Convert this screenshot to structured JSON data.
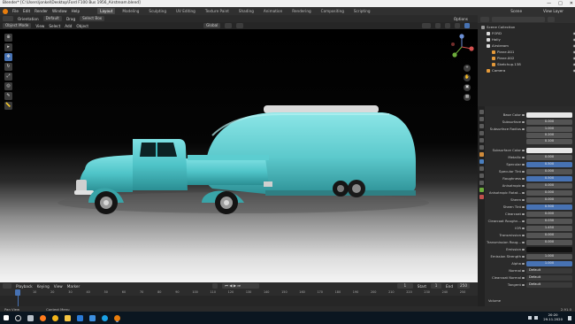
{
  "window": {
    "title": "Blender* [C:\\Users\\jonkel\\Desktop\\Ford F100 Bus 1956_Airstream.blend]",
    "controls": [
      "—",
      "□",
      "✕"
    ]
  },
  "menus": [
    "File",
    "Edit",
    "Render",
    "Window",
    "Help"
  ],
  "workspaces": [
    "Layout",
    "Modeling",
    "Sculpting",
    "UV Editing",
    "Texture Paint",
    "Shading",
    "Animation",
    "Rendering",
    "Compositing",
    "Scripting"
  ],
  "active_workspace": "Layout",
  "scene": {
    "label": "Scene",
    "view_layer": "View Layer"
  },
  "toolbar": {
    "orientation": "Orientation",
    "orientation_value": "Default",
    "drag_label": "Drag",
    "drag_value": "Select Box",
    "options_label": "Options"
  },
  "viewport_header": {
    "mode": "Object Mode",
    "menus": [
      "View",
      "Select",
      "Add",
      "Object"
    ],
    "transform_space": "Global"
  },
  "left_tools": [
    "cursor-icon",
    "select-icon",
    "move-icon",
    "rotate-icon",
    "scale-icon",
    "transform-icon",
    "annotate-icon",
    "measure-icon"
  ],
  "outliner": {
    "header": "Scene Collection",
    "rows": [
      {
        "name": "Scene Collection",
        "indent": 0,
        "color": "#9a9a9a",
        "eye": false
      },
      {
        "name": "FORD",
        "indent": 1,
        "color": "#d9d9d9",
        "eye": true
      },
      {
        "name": "Holly",
        "indent": 1,
        "color": "#d9d9d9",
        "eye": true
      },
      {
        "name": "Airstream",
        "indent": 1,
        "color": "#d9d9d9",
        "eye": true
      },
      {
        "name": "Plane.001",
        "indent": 2,
        "color": "#e59a3a",
        "eye": true
      },
      {
        "name": "Plane.002",
        "indent": 2,
        "color": "#e59a3a",
        "eye": true
      },
      {
        "name": "Sketchup.138",
        "indent": 2,
        "color": "#e59a3a",
        "eye": true
      },
      {
        "name": "Camera",
        "indent": 1,
        "color": "#e59a3a",
        "eye": true
      }
    ]
  },
  "properties": {
    "color_swatch": "#e6e6e6",
    "rows": [
      {
        "label": "Base Color",
        "value": "",
        "style": "white"
      },
      {
        "label": "Subsurface",
        "value": "0.000",
        "style": "gray"
      },
      {
        "label": "Subsurface Radius",
        "value": "1.000",
        "style": "gray"
      },
      {
        "label": "",
        "value": "0.200",
        "style": "gray"
      },
      {
        "label": "",
        "value": "0.100",
        "style": "gray"
      },
      {
        "label": "Subsurface Color",
        "value": "",
        "style": "white"
      },
      {
        "label": "Metallic",
        "value": "0.000",
        "style": "gray"
      },
      {
        "label": "Specular",
        "value": "0.500",
        "style": "blue"
      },
      {
        "label": "Specular Tint",
        "value": "0.000",
        "style": "gray"
      },
      {
        "label": "Roughness",
        "value": "0.500",
        "style": "blue"
      },
      {
        "label": "Anisotropic",
        "value": "0.000",
        "style": "gray"
      },
      {
        "label": "Anisotropic Rotat...",
        "value": "0.000",
        "style": "gray"
      },
      {
        "label": "Sheen",
        "value": "0.000",
        "style": "gray"
      },
      {
        "label": "Sheen Tint",
        "value": "0.500",
        "style": "blue"
      },
      {
        "label": "Clearcoat",
        "value": "0.000",
        "style": "gray"
      },
      {
        "label": "Clearcoat Roughn...",
        "value": "0.030",
        "style": "gray"
      },
      {
        "label": "IOR",
        "value": "1.450",
        "style": "gray"
      },
      {
        "label": "Transmission",
        "value": "0.000",
        "style": "gray"
      },
      {
        "label": "Transmission Roug...",
        "value": "0.000",
        "style": "gray"
      },
      {
        "label": "Emission",
        "value": "",
        "style": "dark"
      },
      {
        "label": "Emission Strength",
        "value": "1.000",
        "style": "gray"
      },
      {
        "label": "Alpha",
        "value": "1.000",
        "style": "blue"
      },
      {
        "label": "Normal",
        "value": "Default",
        "style": "dark"
      },
      {
        "label": "Clearcoat Normal",
        "value": "Default",
        "style": "dark"
      },
      {
        "label": "Tangent",
        "value": "Default",
        "style": "dark"
      },
      {
        "label": "Volume",
        "value": "",
        "style": "dark"
      }
    ]
  },
  "timeline": {
    "menus": [
      "Playback",
      "Keying",
      "View",
      "Marker"
    ],
    "frame": "1",
    "start_label": "Start",
    "start": "1",
    "end_label": "End",
    "end": "250",
    "ticks": [
      "0",
      "10",
      "20",
      "30",
      "40",
      "50",
      "60",
      "70",
      "80",
      "90",
      "100",
      "110",
      "120",
      "130",
      "140",
      "150",
      "160",
      "170",
      "180",
      "190",
      "200",
      "210",
      "220",
      "230",
      "240",
      "250"
    ]
  },
  "status_bar": {
    "items": [
      "Pan View",
      "Context Menu"
    ],
    "version": "2.91.0"
  },
  "taskbar": {
    "icons": [
      "windows-icon",
      "search-icon",
      "task-view-icon",
      "firefox-icon",
      "chrome-icon",
      "explorer-icon",
      "store-icon",
      "mail-icon",
      "edge-icon",
      "blender-icon"
    ],
    "time": "20:20",
    "date": "29.11.2020"
  }
}
